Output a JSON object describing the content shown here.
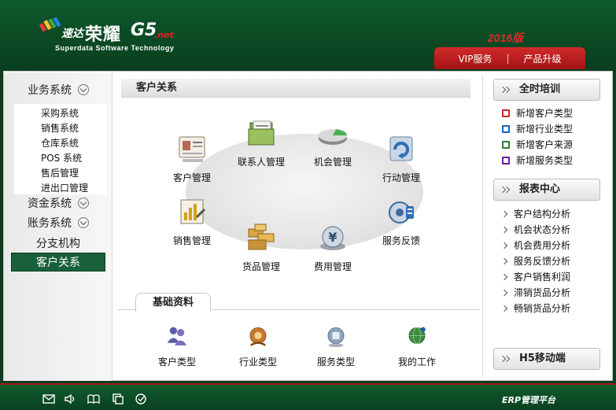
{
  "header": {
    "logo_cn_small": "速达",
    "logo_cn_big": "荣耀",
    "logo_g5": "G5",
    "logo_net": ".net",
    "logo_en": "Superdata Software Technology",
    "version": "2016版",
    "nav": [
      "VIP服务",
      "|",
      "产品升级"
    ]
  },
  "sidebar": {
    "business_head": "业务系统",
    "business_items": [
      "采购系统",
      "销售系统",
      "仓库系统",
      "POS 系统",
      "售后管理",
      "进出口管理"
    ],
    "funds_head": "资金系统",
    "accounts_head": "账务系统",
    "branch": "分支机构",
    "active": "客户关系"
  },
  "main": {
    "section_title": "客户关系",
    "modules": [
      "客户管理",
      "联系人管理",
      "机会管理",
      "行动管理",
      "销售管理",
      "货品管理",
      "费用管理",
      "服务反馈"
    ],
    "basic_tab": "基础资料",
    "basic_items": [
      "客户类型",
      "行业类型",
      "服务类型",
      "我的工作"
    ]
  },
  "right": {
    "training_head": "全时培训",
    "training_items": [
      "新增客户类型",
      "新增行业类型",
      "新增客户来源",
      "新增服务类型"
    ],
    "report_head": "报表中心",
    "report_items": [
      "客户结构分析",
      "机会状态分析",
      "机会费用分析",
      "服务反馈分析",
      "客户销售利润",
      "滞销货品分析",
      "畅销货品分析"
    ],
    "mobile_head": "H5移动端"
  },
  "footer": {
    "icons": [
      "mail-icon",
      "sound-icon",
      "book-icon",
      "copy-icon",
      "check-icon"
    ],
    "platform": "ERP管理平台"
  },
  "colors": {
    "header_green": "#0b4a24",
    "active_green": "#17603a",
    "accent_red": "#c21f1f"
  }
}
